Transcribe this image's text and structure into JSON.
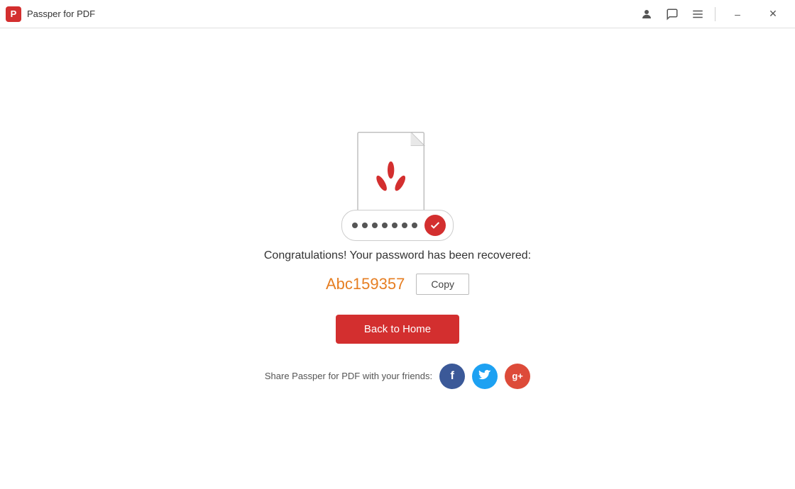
{
  "app": {
    "title": "Passper for PDF",
    "icon_label": "P"
  },
  "titlebar": {
    "account_icon": "👤",
    "chat_icon": "💬",
    "menu_icon": "☰",
    "minimize_label": "–",
    "close_label": "✕"
  },
  "main": {
    "congrats_text": "Congratulations! Your password has been recovered:",
    "password_value": "Abc159357",
    "copy_button_label": "Copy",
    "back_home_label": "Back to Home",
    "share_label": "Share Passper for PDF with your friends:",
    "dots_count": 7
  },
  "social": {
    "facebook_label": "f",
    "twitter_label": "t",
    "googleplus_label": "g+"
  }
}
